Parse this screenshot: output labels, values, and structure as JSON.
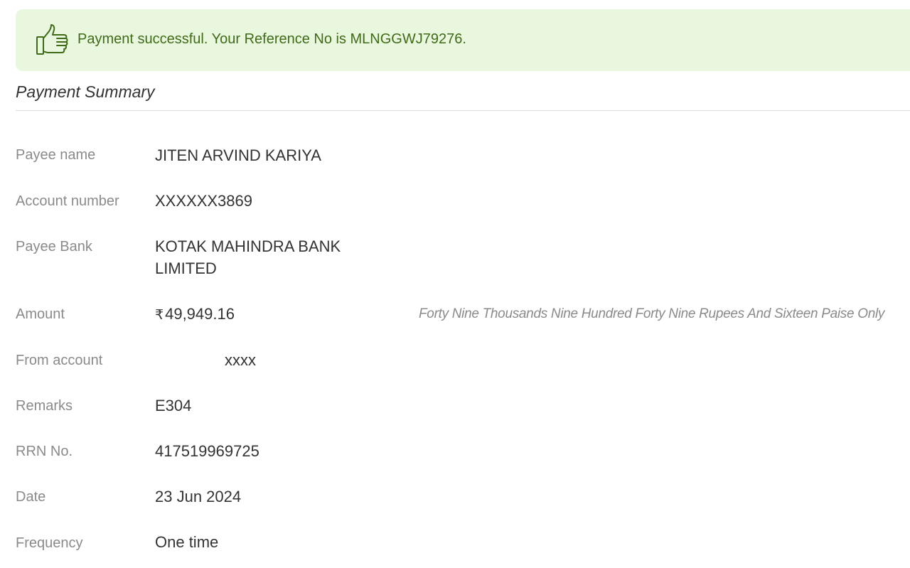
{
  "banner": {
    "icon": "thumbs-up-icon",
    "message": "Payment successful. Your Reference No is MLNGGWJ79276.",
    "bg_color": "#eaf7df",
    "text_color": "#3f6b17"
  },
  "summary": {
    "title": "Payment Summary",
    "rows": {
      "payee_name": {
        "label": "Payee name",
        "value": "JITEN ARVIND KARIYA"
      },
      "account_number": {
        "label": "Account number",
        "value": "XXXXXX3869"
      },
      "payee_bank": {
        "label": "Payee Bank",
        "value_line1": "KOTAK MAHINDRA BANK",
        "value_line2": "LIMITED"
      },
      "amount": {
        "label": "Amount",
        "currency": "₹",
        "value": "49,949.16",
        "in_words": "Forty Nine Thousands Nine Hundred Forty Nine Rupees And Sixteen Paise Only"
      },
      "from_account": {
        "label": "From account",
        "value": "xxxx"
      },
      "remarks": {
        "label": "Remarks",
        "value": "E304"
      },
      "rrn": {
        "label": "RRN No.",
        "value": "417519969725"
      },
      "date": {
        "label": "Date",
        "value": "23 Jun 2024"
      },
      "frequency": {
        "label": "Frequency",
        "value": "One time"
      }
    }
  }
}
